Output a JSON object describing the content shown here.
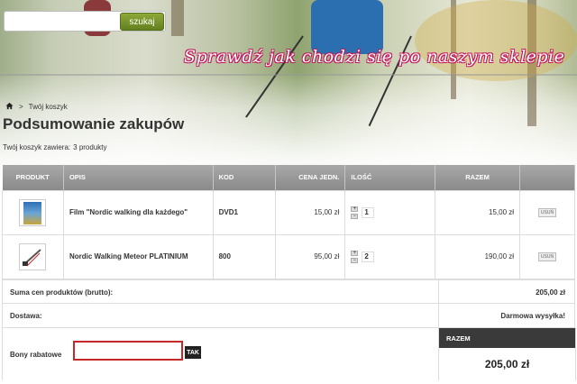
{
  "header": {
    "search": {
      "placeholder": "",
      "value": "",
      "button_label": "szukaj"
    },
    "slogan": "Sprawdź jak chodzi się po naszym sklepie"
  },
  "breadcrumb": {
    "home_icon": "home-icon",
    "separator": ">",
    "current": "Twój koszyk"
  },
  "page_title": "Podsumowanie zakupów",
  "cart_summary": {
    "label": "Twój koszyk zawiera:",
    "count": "3 produkty"
  },
  "table": {
    "headers": [
      "PRODUKT",
      "OPIS",
      "KOD",
      "CENA JEDN.",
      "ILOŚĆ",
      "RAZEM",
      ""
    ],
    "rows": [
      {
        "description": "Film \"Nordic walking dla każdego\"",
        "code": "DVD1",
        "unit_price": "15,00 zł",
        "quantity": "1",
        "total": "15,00 zł",
        "delete_label": "USUŃ"
      },
      {
        "description": "Nordic Walking Meteor PLATINIUM",
        "code": "800",
        "unit_price": "95,00 zł",
        "quantity": "2",
        "total": "190,00 zł",
        "delete_label": "USUŃ"
      }
    ],
    "qty_plus": "+",
    "qty_minus": "−"
  },
  "summary": {
    "products_label": "Suma cen produktów (brutto):",
    "products_value": "205,00 zł",
    "shipping_label": "Dostawa:",
    "shipping_value": "Darmowa wysyłka!",
    "voucher_label": "Bony rabatowe",
    "voucher_value": "",
    "voucher_button": "TAK",
    "total_label": "RAZEM",
    "total_value": "205,00 zł"
  },
  "colors": {
    "accent_green": "#6f8c26",
    "voucher_border": "#c62828",
    "header_gray": "#999999",
    "total_head": "#3a3a3a"
  }
}
